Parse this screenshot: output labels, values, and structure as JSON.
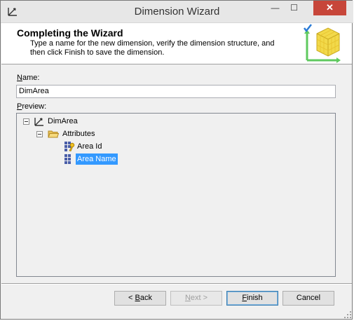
{
  "window": {
    "title": "Dimension Wizard",
    "controls": {
      "minimize": "—",
      "maximize": "☐",
      "close": "✕"
    }
  },
  "header": {
    "title": "Completing the Wizard",
    "description": "Type a name for the new dimension, verify the dimension structure, and then click Finish to save the dimension."
  },
  "name_field": {
    "label_accel": "N",
    "label_rest": "ame:",
    "value": "DimArea"
  },
  "preview": {
    "label_accel": "P",
    "label_rest": "review:",
    "tree": {
      "root": "DimArea",
      "folder": "Attributes",
      "items": [
        "Area Id",
        "Area Name"
      ],
      "selected": "Area Name"
    }
  },
  "buttons": {
    "back_prefix": "< ",
    "back_accel": "B",
    "back_rest": "ack",
    "next_accel": "N",
    "next_rest": "ext >",
    "finish_accel": "F",
    "finish_rest": "inish",
    "cancel": "Cancel"
  },
  "colors": {
    "selection": "#3399ff",
    "close_button": "#c7463a"
  },
  "icons": {
    "app": "dimension-icon",
    "wizard": "cube-icon",
    "root": "dimension-icon",
    "folder": "folder-icon",
    "key_attribute": "key-attribute-icon",
    "attribute": "attribute-icon"
  }
}
